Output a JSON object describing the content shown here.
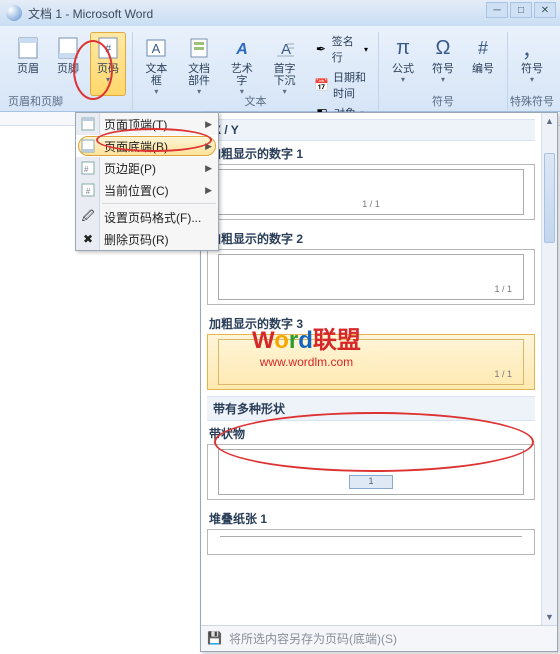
{
  "window": {
    "title": "文档 1 - Microsoft Word"
  },
  "ribbon": {
    "group_hf": {
      "name": "页眉和页脚",
      "header": "页眉",
      "footer": "页脚",
      "pagenum": "页码"
    },
    "group_text": {
      "name": "文本",
      "textbox": "文本框",
      "quickparts": "文档部件",
      "wordart": "艺术字",
      "dropcap": "首字下沉",
      "sigline": "签名行",
      "datetime": "日期和时间",
      "object": "对象"
    },
    "group_sym": {
      "name": "符号",
      "equation": "公式",
      "symbol": "符号",
      "number": "编号"
    },
    "group_special": {
      "name": "特殊符号",
      "symbol": "符号"
    }
  },
  "dropdown": {
    "top": "页面顶端(T)",
    "bottom": "页面底端(B)",
    "margin": "页边距(P)",
    "current": "当前位置(C)",
    "format": "设置页码格式(F)...",
    "remove": "删除页码(R)"
  },
  "gallery": {
    "cat_xy": "X / Y",
    "item1": "加粗显示的数字 1",
    "item2": "加粗显示的数字 2",
    "item3": "加粗显示的数字 3",
    "cat_shapes": "带有多种形状",
    "item_ribbon": "带状物",
    "item_stack": "堆叠纸张 1",
    "sample_pg": "1 / 1",
    "footer": "将所选内容另存为页码(底端)(S)"
  },
  "watermark": {
    "word": "Word",
    "cn": "联盟",
    "url": "www.wordlm.com"
  }
}
